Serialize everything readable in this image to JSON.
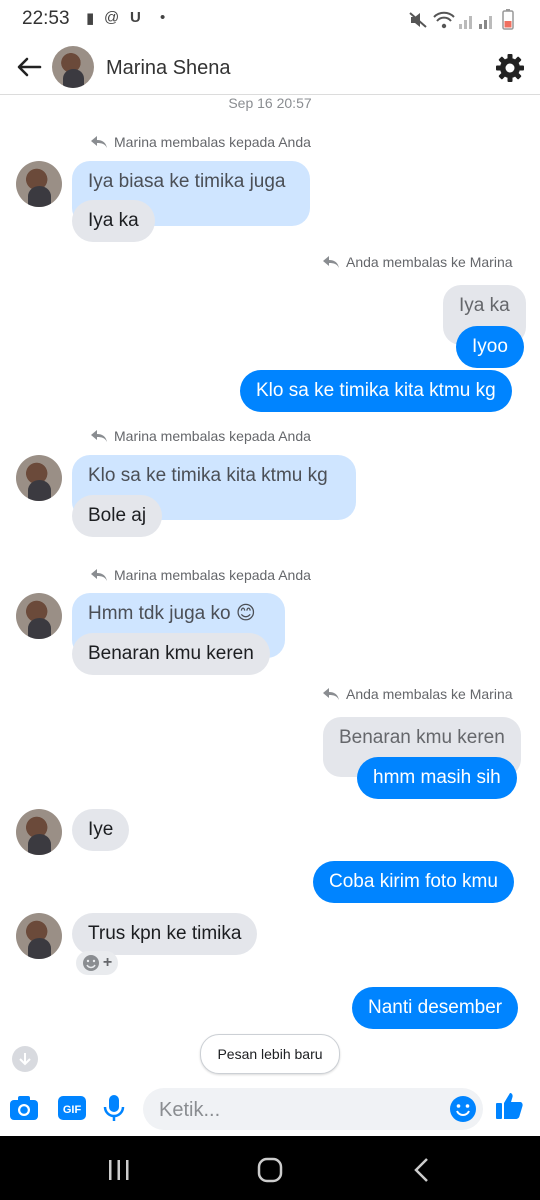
{
  "status_bar": {
    "time": "22:53"
  },
  "header": {
    "contact_name": "Marina Shena"
  },
  "chat": {
    "timestamp": "Sep 16 20:57",
    "reply_marina": "Marina membalas kepada Anda",
    "reply_anda": "Anda membalas ke Marina",
    "m1_quote": "Iya biasa ke timika juga",
    "m1_text": "Iya ka",
    "m2_quote": "Iya ka",
    "m2_text1": "Iyoo",
    "m2_text2": "Klo sa ke timika kita ktmu kg",
    "m3_quote": "Klo sa ke timika kita ktmu kg",
    "m3_text": "Bole aj",
    "m4_quote": "Hmm tdk juga ko 😊",
    "m4_text": "Benaran kmu keren",
    "m5_quote": "Benaran kmu keren",
    "m5_text": "hmm masih sih",
    "m6_text": "Iye",
    "m7_text": "Coba kirim foto kmu",
    "m8_text": "Trus kpn ke timika",
    "m9_text": "Nanti desember",
    "newer_button": "Pesan lebih baru"
  },
  "composer": {
    "placeholder": "Ketik..."
  },
  "colors": {
    "accent": "#0084ff",
    "quote_in": "#cfe5ff",
    "bubble_in": "#e4e6eb"
  }
}
